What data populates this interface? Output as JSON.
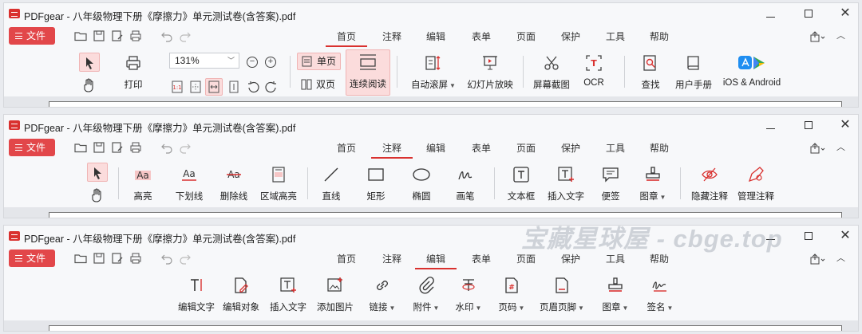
{
  "window": {
    "title": "PDFgear - 八年级物理下册《摩擦力》单元测试卷(含答案).pdf",
    "file_button": "文件"
  },
  "menu_tabs": [
    "首页",
    "注释",
    "编辑",
    "表单",
    "页面",
    "保护",
    "工具",
    "帮助"
  ],
  "panel1": {
    "active_tab": "首页",
    "print_label": "打印",
    "zoom_value": "131%",
    "single_page": "单页",
    "double_page": "双页",
    "continuous_read": "连续阅读",
    "auto_scroll": "自动滚屏",
    "slideshow": "幻灯片放映",
    "screenshot": "屏幕截图",
    "ocr": "OCR",
    "find": "查找",
    "user_manual": "用户手册",
    "ios_android": "iOS & Android"
  },
  "panel2": {
    "active_tab": "注释",
    "highlight": "高亮",
    "underline": "下划线",
    "strikethrough": "删除线",
    "area_highlight": "区域高亮",
    "line": "直线",
    "rectangle": "矩形",
    "ellipse": "椭圆",
    "pen": "画笔",
    "text_box": "文本框",
    "insert_text": "插入文字",
    "sticky_note": "便签",
    "stamp": "图章",
    "hide_annotations": "隐藏注释",
    "manage_annotations": "管理注释"
  },
  "panel3": {
    "active_tab": "编辑",
    "edit_text": "编辑文字",
    "edit_object": "编辑对象",
    "insert_text": "插入文字",
    "add_image": "添加图片",
    "link": "链接",
    "attachment": "附件",
    "watermark": "水印",
    "page_number": "页码",
    "header_footer": "页眉页脚",
    "stamp": "图章",
    "signature": "签名"
  },
  "watermark_text": "宝藏星球屋 - cbge.top",
  "colors": {
    "accent": "#d9312f",
    "file_button": "#e2474a",
    "highlight_bg": "#fbdcdc"
  }
}
